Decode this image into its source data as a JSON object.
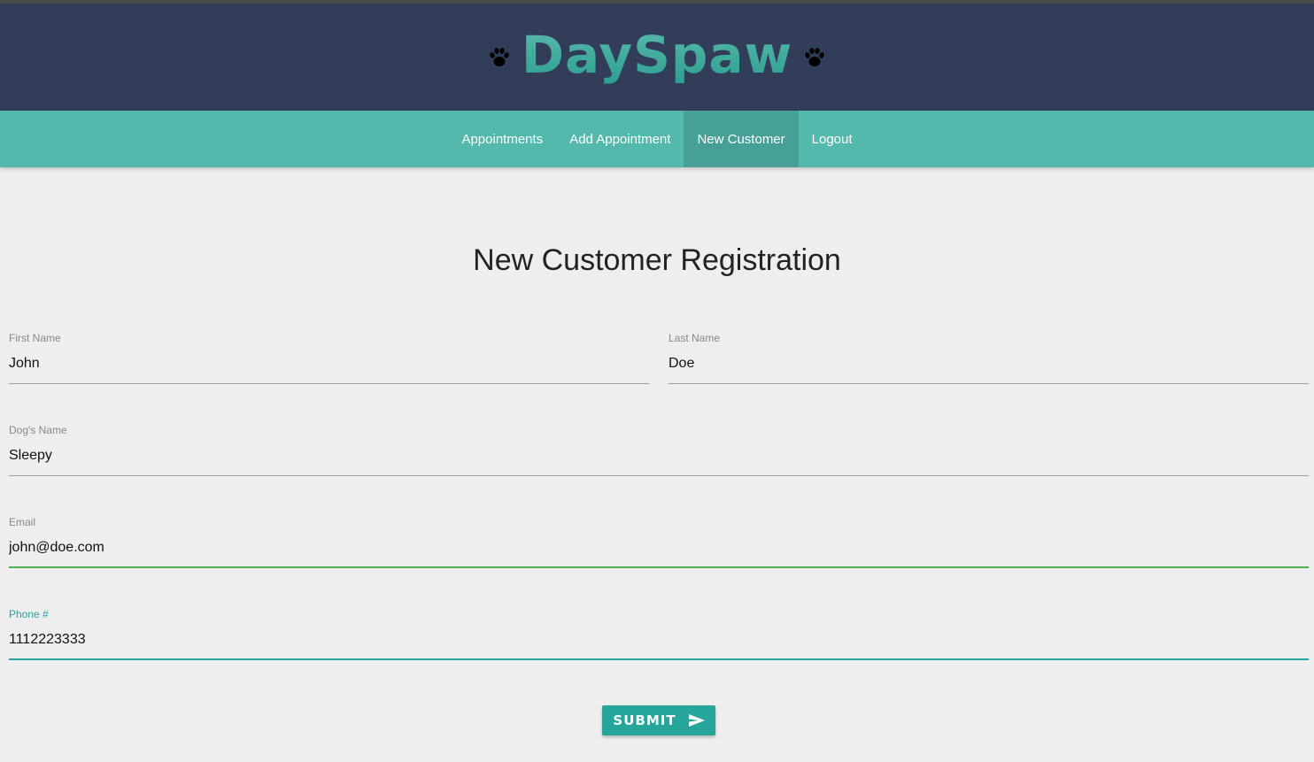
{
  "brand": {
    "title": "DaySpaw",
    "icon_left": "paw-icon",
    "icon_right": "paw-icon"
  },
  "nav": {
    "items": [
      {
        "label": "Appointments",
        "active": false
      },
      {
        "label": "Add Appointment",
        "active": false
      },
      {
        "label": "New Customer",
        "active": true
      },
      {
        "label": "Logout",
        "active": false
      }
    ]
  },
  "page": {
    "title": "New Customer Registration"
  },
  "form": {
    "first_name": {
      "label": "First Name",
      "value": "John"
    },
    "last_name": {
      "label": "Last Name",
      "value": "Doe"
    },
    "dog_name": {
      "label": "Dog's Name",
      "value": "Sleepy"
    },
    "email": {
      "label": "Email",
      "value": "john@doe.com",
      "state": "valid"
    },
    "phone": {
      "label": "Phone #",
      "value": "1112223333",
      "state": "focused"
    },
    "submit_label": "SUBMIT",
    "submit_icon": "send-icon"
  },
  "colors": {
    "header_bg": "#323d59",
    "nav_bg": "#54b8ad",
    "nav_active_bg": "#47a095",
    "accent": "#26a69a",
    "valid": "#4caf50",
    "page_bg": "#eeeeee"
  }
}
